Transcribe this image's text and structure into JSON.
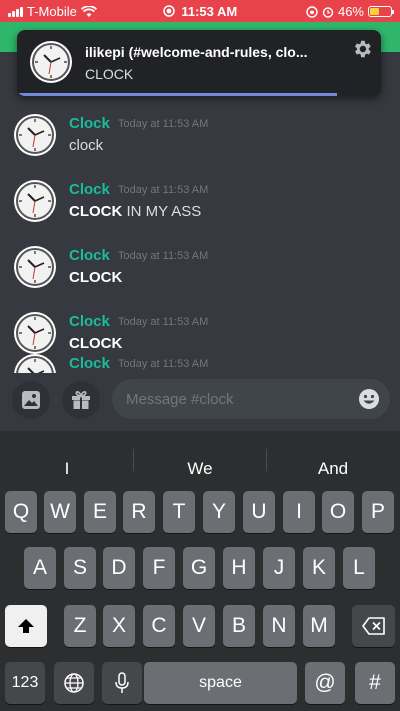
{
  "status_bar": {
    "carrier": "T-Mobile",
    "time": "11:53 AM",
    "battery": "46%",
    "battery_level": 0.46
  },
  "notification": {
    "title": "ilikepi (#welcome-and-rules, clo...",
    "body": "CLOCK",
    "icon": "gear-icon"
  },
  "messages": [
    {
      "author": "Clock",
      "timestamp": "Today at 11:53 AM",
      "bold": "",
      "text": "clock"
    },
    {
      "author": "Clock",
      "timestamp": "Today at 11:53 AM",
      "bold": "CLOCK",
      "text": " IN MY ASS"
    },
    {
      "author": "Clock",
      "timestamp": "Today at 11:53 AM",
      "bold": "CLOCK",
      "text": ""
    },
    {
      "author": "Clock",
      "timestamp": "Today at 11:53 AM",
      "bold": "CLOCK",
      "text": ""
    },
    {
      "author": "Clock",
      "timestamp": "Today at 11:53 AM",
      "bold": "",
      "text": ""
    }
  ],
  "composer": {
    "placeholder": "Message #clock",
    "icons": [
      "image-icon",
      "gift-icon",
      "emoji-icon"
    ]
  },
  "keyboard": {
    "suggestions": [
      "I",
      "We",
      "And"
    ],
    "row1": [
      "Q",
      "W",
      "E",
      "R",
      "T",
      "Y",
      "U",
      "I",
      "O",
      "P"
    ],
    "row2": [
      "A",
      "S",
      "D",
      "F",
      "G",
      "H",
      "J",
      "K",
      "L"
    ],
    "row3": [
      "Z",
      "X",
      "C",
      "V",
      "B",
      "N",
      "M"
    ],
    "numbers_key": "123",
    "space_key": "space",
    "at_key": "@",
    "hash_key": "#"
  }
}
